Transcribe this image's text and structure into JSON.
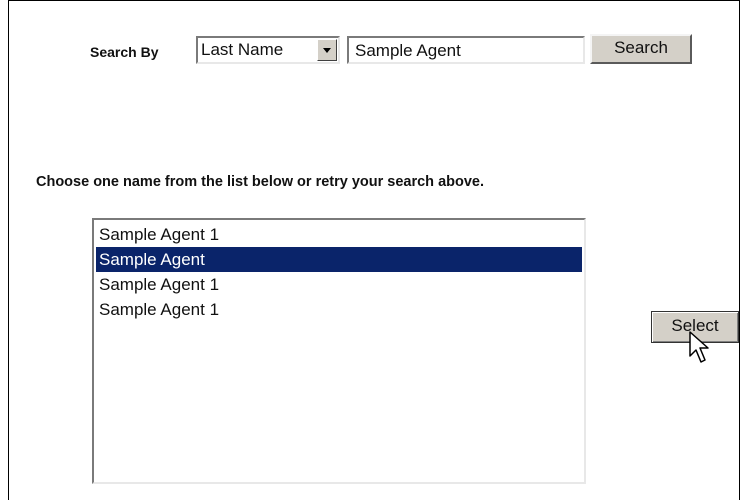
{
  "search": {
    "label": "Search By",
    "field_selected": "Last Name",
    "query_value": "Sample Agent",
    "button_label": "Search"
  },
  "instructions": "Choose one name from the list below or retry your search above.",
  "results": {
    "items": [
      {
        "label": "Sample Agent 1",
        "selected": false
      },
      {
        "label": "Sample Agent",
        "selected": true
      },
      {
        "label": "Sample Agent 1",
        "selected": false
      },
      {
        "label": "Sample Agent 1",
        "selected": false
      }
    ]
  },
  "select_button_label": "Select",
  "icons": {
    "cursor": "mouse-pointer-icon",
    "dropdown": "chevron-down-icon"
  },
  "colors": {
    "selection_bg": "#0a246a",
    "button_face": "#d4d0c8"
  }
}
